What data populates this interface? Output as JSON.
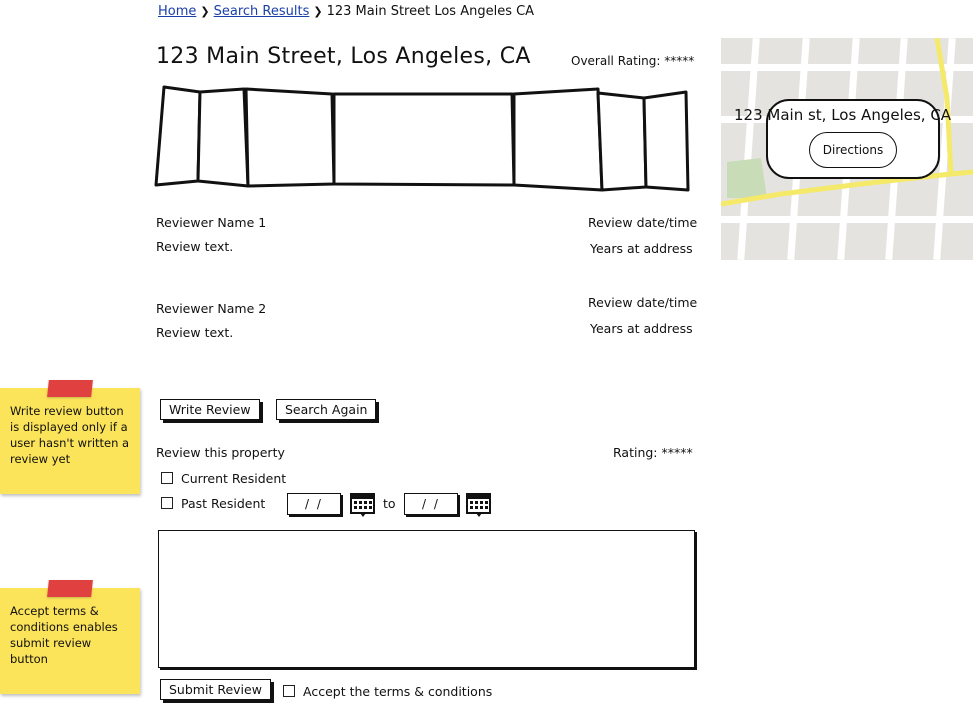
{
  "breadcrumb": {
    "home": "Home",
    "search_results": "Search Results",
    "current": "123 Main Street Los Angeles CA"
  },
  "property": {
    "title": "123 Main Street, Los Angeles, CA",
    "overall_rating": "Overall Rating: *****"
  },
  "reviews": [
    {
      "name": "Reviewer Name 1",
      "text": "Review text.",
      "date": "Review date/time",
      "years": "Years at address"
    },
    {
      "name": "Reviewer Name 2",
      "text": "Review text.",
      "date": "Review date/time",
      "years": "Years at address"
    }
  ],
  "actions": {
    "write_review": "Write Review",
    "search_again": "Search Again"
  },
  "review_form": {
    "heading": "Review this property",
    "rating": "Rating:  *****",
    "current_resident": "Current Resident",
    "past_resident": "Past Resident",
    "date_from": "/ /",
    "to": "to",
    "date_to": "/ /",
    "submit": "Submit Review",
    "accept_terms": "Accept the terms & conditions"
  },
  "map": {
    "label": "123 Main st, Los Angeles, CA",
    "directions": "Directions"
  },
  "notes": {
    "write_review_note": "Write review button is displayed only if a user hasn't written a review yet",
    "terms_note": "Accept terms & conditions enables submit review button"
  },
  "colors": {
    "sticky": "#fbe35a",
    "tape": "#e04040",
    "link": "#1a3fa8",
    "map_road": "#f5e96a",
    "map_park": "#c8dcb8"
  }
}
